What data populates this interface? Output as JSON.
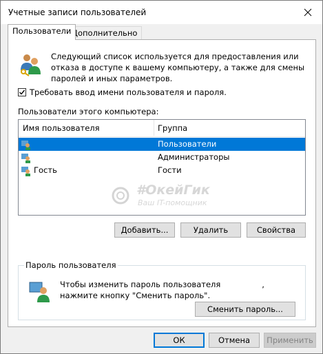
{
  "window": {
    "title": "Учетные записи пользователей"
  },
  "tabs": [
    {
      "label": "Пользователи",
      "active": true
    },
    {
      "label": "Дополнительно",
      "active": false
    }
  ],
  "users_tab": {
    "description": "Следующий список используется для предоставления или отказа в доступе к вашему компьютеру, а также для смены паролей и иных параметров.",
    "require_login": {
      "label": "Требовать ввод имени пользователя и пароля.",
      "checked": true
    },
    "list_label": "Пользователи этого компьютера:",
    "columns": [
      "Имя пользователя",
      "Группа"
    ],
    "rows": [
      {
        "name": "",
        "group": "Пользователи",
        "selected": true
      },
      {
        "name": "",
        "group": "Администраторы",
        "selected": false
      },
      {
        "name": "Гость",
        "group": "Гости",
        "selected": false
      }
    ],
    "buttons": {
      "add": "Добавить...",
      "remove": "Удалить",
      "properties": "Свойства"
    },
    "password_group": {
      "title": "Пароль пользователя",
      "text_part1": "Чтобы изменить пароль пользователя",
      "text_part2": ", нажмите кнопку \"Сменить пароль\".",
      "change_button": "Сменить пароль..."
    }
  },
  "watermark": {
    "line1": "#ОкейГик",
    "line2": "Ваш IT-помощник"
  },
  "footer": {
    "ok": "ОК",
    "cancel": "Отмена",
    "apply": "Применить"
  },
  "colors": {
    "selection": "#0078d7",
    "accent_border": "#0078d7",
    "panel_bg": "#f0f0f0"
  }
}
